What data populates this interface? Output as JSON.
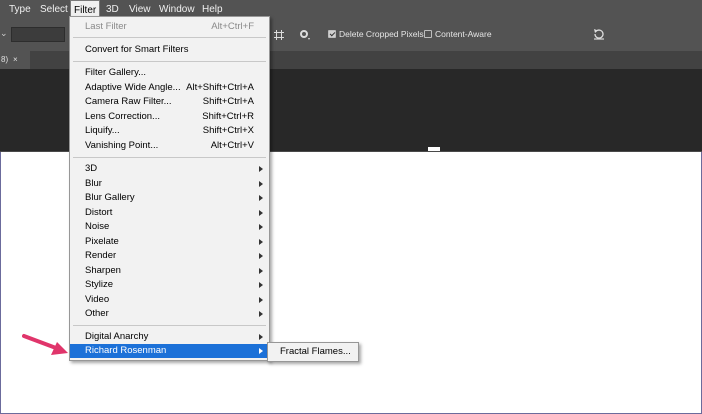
{
  "menubar": {
    "items": [
      "Type",
      "Select",
      "Filter",
      "3D",
      "View",
      "Window",
      "Help"
    ],
    "active": "Filter"
  },
  "options": {
    "delete_cropped_label": "Delete Cropped Pixels",
    "delete_cropped_checked": true,
    "content_aware_label": "Content-Aware",
    "content_aware_checked": false
  },
  "doc_tab": {
    "name": "8)",
    "close": "×"
  },
  "filter_menu": {
    "items": [
      {
        "label": "Last Filter",
        "shortcut": "Alt+Ctrl+F",
        "disabled": true
      },
      {
        "label": "Convert for Smart Filters"
      },
      {
        "label": "Filter Gallery..."
      },
      {
        "label": "Adaptive Wide Angle...",
        "shortcut": "Alt+Shift+Ctrl+A"
      },
      {
        "label": "Camera Raw Filter...",
        "shortcut": "Shift+Ctrl+A"
      },
      {
        "label": "Lens Correction...",
        "shortcut": "Shift+Ctrl+R"
      },
      {
        "label": "Liquify...",
        "shortcut": "Shift+Ctrl+X"
      },
      {
        "label": "Vanishing Point...",
        "shortcut": "Alt+Ctrl+V"
      },
      {
        "label": "3D",
        "submenu": true
      },
      {
        "label": "Blur",
        "submenu": true
      },
      {
        "label": "Blur Gallery",
        "submenu": true
      },
      {
        "label": "Distort",
        "submenu": true
      },
      {
        "label": "Noise",
        "submenu": true
      },
      {
        "label": "Pixelate",
        "submenu": true
      },
      {
        "label": "Render",
        "submenu": true
      },
      {
        "label": "Sharpen",
        "submenu": true
      },
      {
        "label": "Stylize",
        "submenu": true
      },
      {
        "label": "Video",
        "submenu": true
      },
      {
        "label": "Other",
        "submenu": true
      },
      {
        "label": "Digital Anarchy",
        "submenu": true
      },
      {
        "label": "Richard Rosenman",
        "submenu": true,
        "highlighted": true
      }
    ]
  },
  "submenu": {
    "items": [
      "Fractal Flames..."
    ]
  },
  "annotation": {
    "arrow_color": "#e0356b"
  },
  "colors": {
    "highlight": "#1c71d8",
    "menubar_bg": "#535353",
    "canvas_dark": "#282828"
  },
  "icons": [
    "grid-icon",
    "gear-icon",
    "reset-icon",
    "checkbox-checked-icon",
    "checkbox-icon",
    "submenu-arrow-icon",
    "pink-arrow-icon"
  ]
}
